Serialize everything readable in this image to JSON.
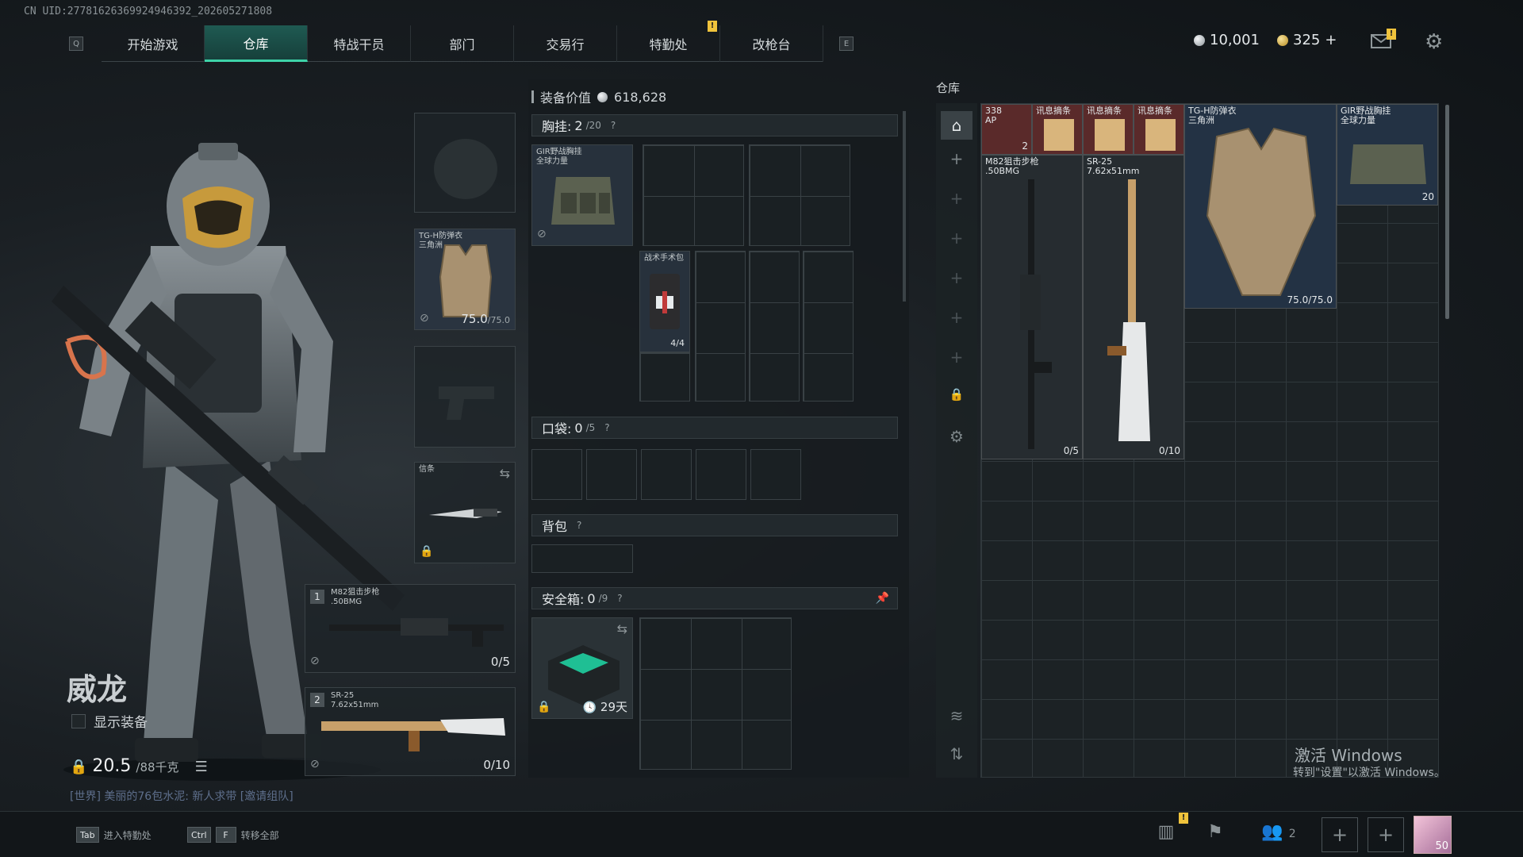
{
  "uid": "CN UID:27781626369924946392_202605271808",
  "nav": {
    "left_key": "Q",
    "right_key": "E",
    "tabs": [
      "开始游戏",
      "仓库",
      "特战干员",
      "部门",
      "交易行",
      "特勤处",
      "改枪台"
    ],
    "active_index": 1,
    "alert": "!"
  },
  "currency": {
    "silver": "10,001",
    "gold": "325",
    "gold_plus": "+"
  },
  "mail_alert": "!",
  "character": {
    "name": "威龙",
    "show_equipment": "显示装备",
    "weight_current": "20.5",
    "weight_max": "/88千克",
    "chat": "[世界] 美丽的76包水泥: 新人求带 [邀请组队]"
  },
  "slots": {
    "armor_label": "TG-H防弹衣\n三角洲",
    "armor_durability": "75.0",
    "armor_durability_max": "/75.0",
    "melee_label": "信条",
    "weapon1_index": "1",
    "weapon1_label": "M82狙击步枪\n.50BMG",
    "weapon1_ammo": "0/5",
    "weapon2_index": "2",
    "weapon2_label": "SR-25\n7.62x51mm",
    "weapon2_ammo": "0/10"
  },
  "middle": {
    "equip_value_label": "装备价值",
    "equip_value": "618,628",
    "chest": {
      "label": "胸挂:",
      "count": "2",
      "cap": "/20",
      "item_label": "GIR野战胸挂\n全球力量"
    },
    "medkit": {
      "label": "战术手术包",
      "count": "4/4"
    },
    "pocket": {
      "label": "口袋:",
      "count": "0",
      "cap": "/5"
    },
    "backpack": {
      "label": "背包"
    },
    "safebox": {
      "label": "安全箱:",
      "count": "0",
      "cap": "/9",
      "days": "29天"
    },
    "question": "?"
  },
  "warehouse": {
    "title": "仓库",
    "items": {
      "ammo_label": "338\nAP",
      "ammo_count": "2",
      "intel1": "讯息摘条",
      "intel2": "讯息摘条",
      "intel3": "讯息摘条",
      "armor_label": "TG-H防弹衣\n三角洲",
      "armor_durability": "75.0/75.0",
      "rig_label": "GIR野战胸挂\n全球力量",
      "rig_count": "20",
      "m82_label": "M82狙击步枪\n.50BMG",
      "m82_ammo": "0/5",
      "sr25_label": "SR-25\n7.62x51mm",
      "sr25_ammo": "0/10"
    }
  },
  "windows": {
    "line1": "激活 Windows",
    "line2": "转到\"设置\"以激活 Windows。"
  },
  "bottom": {
    "hint1_key": "Tab",
    "hint1": "进入特勤处",
    "hint2_key1": "Ctrl",
    "hint2_key2": "F",
    "hint2": "转移全部",
    "friends_count": "2",
    "avatar_level": "50",
    "stats_alert": "!"
  },
  "colors": {
    "accent": "#3ed3a8",
    "tab_active": "#1f5a52",
    "alert": "#f0c33c"
  }
}
